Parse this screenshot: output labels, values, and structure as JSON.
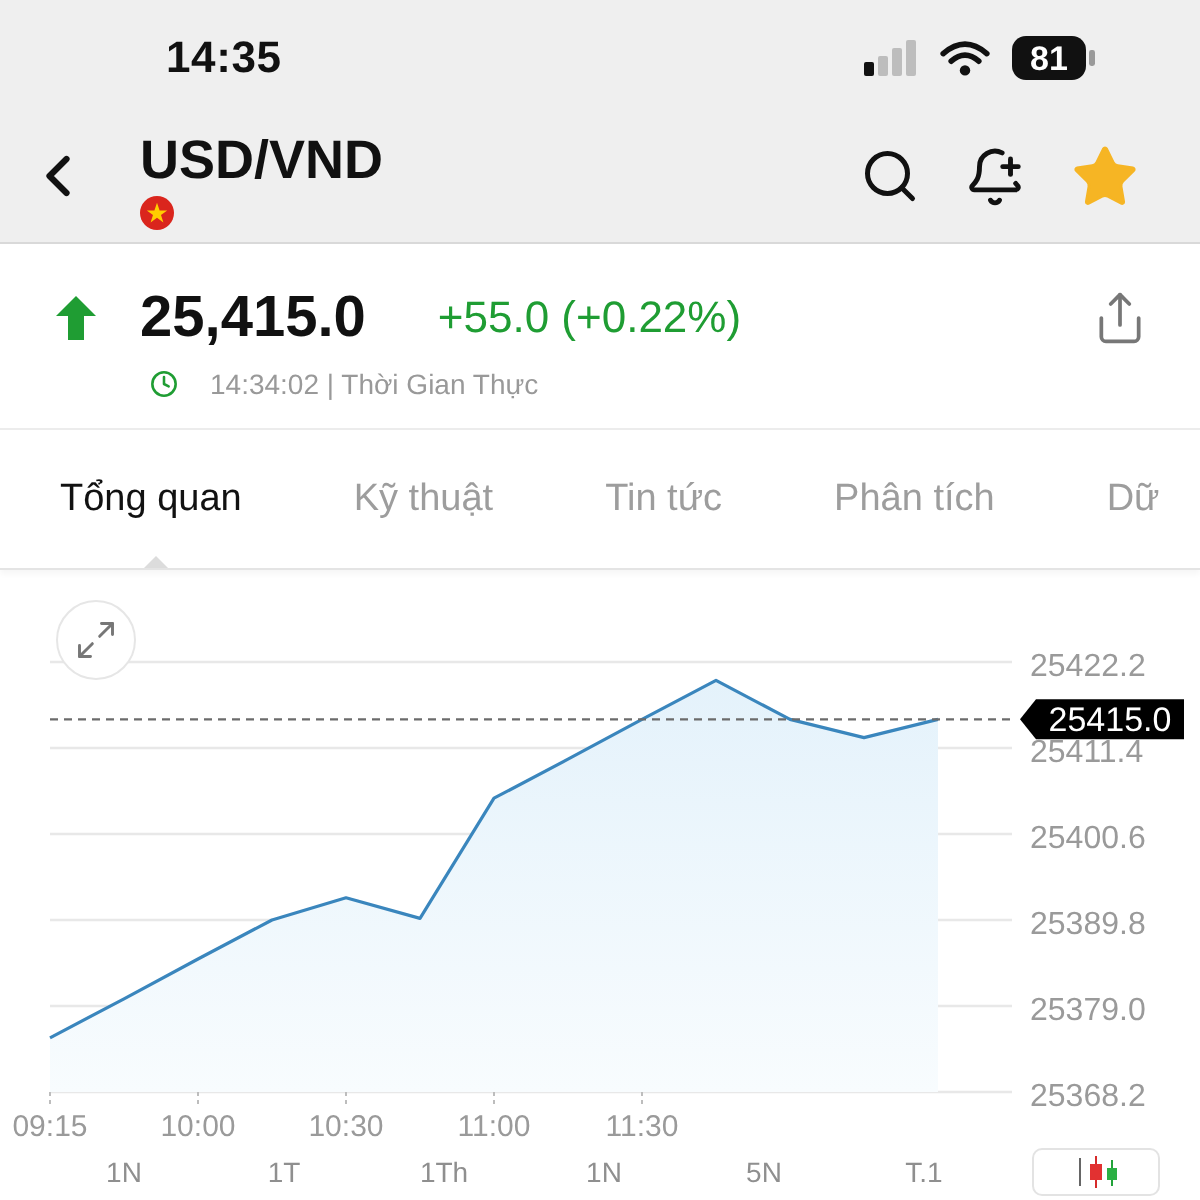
{
  "status_bar": {
    "time": "14:35",
    "battery": "81"
  },
  "header": {
    "title": "USD/VND",
    "favorite": true
  },
  "quote": {
    "rising": true,
    "price": "25,415.0",
    "change": "+55.0 (+0.22%)",
    "updated": "14:34:02 | Thời Gian Thực"
  },
  "tabs": [
    {
      "label": "Tổng quan",
      "selected": true
    },
    {
      "label": "Kỹ thuật",
      "selected": false
    },
    {
      "label": "Tin tức",
      "selected": false
    },
    {
      "label": "Phân tích",
      "selected": false
    },
    {
      "label": "Dữ",
      "selected": false
    }
  ],
  "chart": {
    "chart_data": {
      "type": "area",
      "grid": true,
      "categories": [
        "09:15",
        null,
        "10:00",
        null,
        "10:30",
        null,
        "11:00",
        null,
        "11:30",
        null,
        null,
        null,
        null
      ],
      "series": [
        {
          "color": "#3a86bd",
          "values": [
            25375.0,
            25379.9,
            25384.9,
            25389.8,
            25392.6,
            25390.0,
            25405.1,
            25410.0,
            25415.0,
            25419.9,
            25415.0,
            25412.7,
            25415.0
          ]
        }
      ],
      "ylim": [
        25368.2,
        25422.2
      ],
      "yticks": [
        {
          "value": 25422.2,
          "label": "25422.2"
        },
        {
          "value": 25411.4,
          "label": "25411.4"
        },
        {
          "value": 25400.6,
          "label": "25400.6"
        },
        {
          "value": 25389.8,
          "label": "25389.8"
        },
        {
          "value": 25379.0,
          "label": "25379.0"
        },
        {
          "value": 25368.2,
          "label": "25368.2"
        }
      ],
      "ref_lines": [
        {
          "axis": "y",
          "value": 25415.0,
          "label": "25415.0"
        }
      ]
    }
  },
  "range_options": [
    {
      "label": "1N",
      "selected": false
    },
    {
      "label": "1T",
      "selected": false
    },
    {
      "label": "1Th",
      "selected": false
    },
    {
      "label": "1N",
      "selected": false
    },
    {
      "label": "5N",
      "selected": false
    },
    {
      "label": "T.1",
      "selected": false
    }
  ]
}
